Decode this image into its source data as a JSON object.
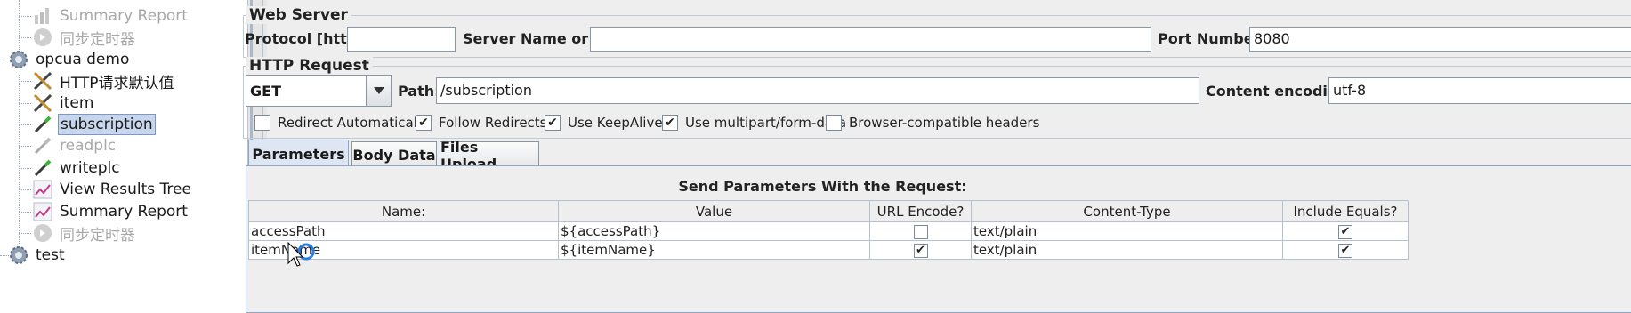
{
  "tree": {
    "items": [
      {
        "label": "Summary Report",
        "icon": "chart-icon",
        "disabled": true
      },
      {
        "label": "同步定时器",
        "icon": "timer-icon",
        "disabled": true
      },
      {
        "label": "opcua demo",
        "icon": "thread-group-gear-icon",
        "disabled": false
      },
      {
        "label": "HTTP请求默认值",
        "icon": "config-tools-icon",
        "disabled": false
      },
      {
        "label": "item",
        "icon": "config-tools-icon",
        "disabled": false
      },
      {
        "label": "subscription",
        "icon": "sampler-pipette-icon",
        "disabled": false,
        "selected": true
      },
      {
        "label": "readplc",
        "icon": "sampler-pipette-icon",
        "disabled": true
      },
      {
        "label": "writeplc",
        "icon": "sampler-pipette-icon",
        "disabled": false
      },
      {
        "label": "View Results Tree",
        "icon": "listener-graph-icon",
        "disabled": false
      },
      {
        "label": "Summary Report",
        "icon": "listener-graph-icon",
        "disabled": false
      },
      {
        "label": "同步定时器",
        "icon": "timer-icon",
        "disabled": true
      },
      {
        "label": "test",
        "icon": "thread-group-gear-icon",
        "disabled": false
      }
    ]
  },
  "web_server": {
    "legend": "Web Server",
    "protocol_label": "Protocol [http]:",
    "protocol_value": "",
    "server_label": "Server Name or IP:",
    "server_value": "",
    "port_label": "Port Number:",
    "port_value": "8080"
  },
  "http_request": {
    "legend": "HTTP Request",
    "method": "GET",
    "path_label": "Path:",
    "path_value": "/subscription",
    "encoding_label": "Content encoding:",
    "encoding_value": "utf-8"
  },
  "options": {
    "redirect_auto": {
      "label": "Redirect Automatically",
      "checked": false
    },
    "follow_redirects": {
      "label": "Follow Redirects",
      "checked": true
    },
    "keepalive": {
      "label": "Use KeepAlive",
      "checked": true
    },
    "multipart": {
      "label": "Use multipart/form-data",
      "checked": true
    },
    "browser_headers": {
      "label": "Browser-compatible headers",
      "checked": false
    }
  },
  "tabs": {
    "parameters": "Parameters",
    "body_data": "Body Data",
    "files_upload": "Files Upload"
  },
  "params_table": {
    "title": "Send Parameters With the Request:",
    "columns": [
      "Name:",
      "Value",
      "URL Encode?",
      "Content-Type",
      "Include Equals?"
    ],
    "rows": [
      {
        "name": "accessPath",
        "value": "${accessPath}",
        "url_encode": false,
        "content_type": "text/plain",
        "include_equals": true
      },
      {
        "name": "itemName",
        "value": "${itemName}",
        "url_encode": true,
        "content_type": "text/plain",
        "include_equals": true
      }
    ]
  },
  "colors": {
    "selection_bg": "#c7d6ec",
    "tab_active_bg": "#dde6f2",
    "disabled_text": "#a8a8a8"
  }
}
